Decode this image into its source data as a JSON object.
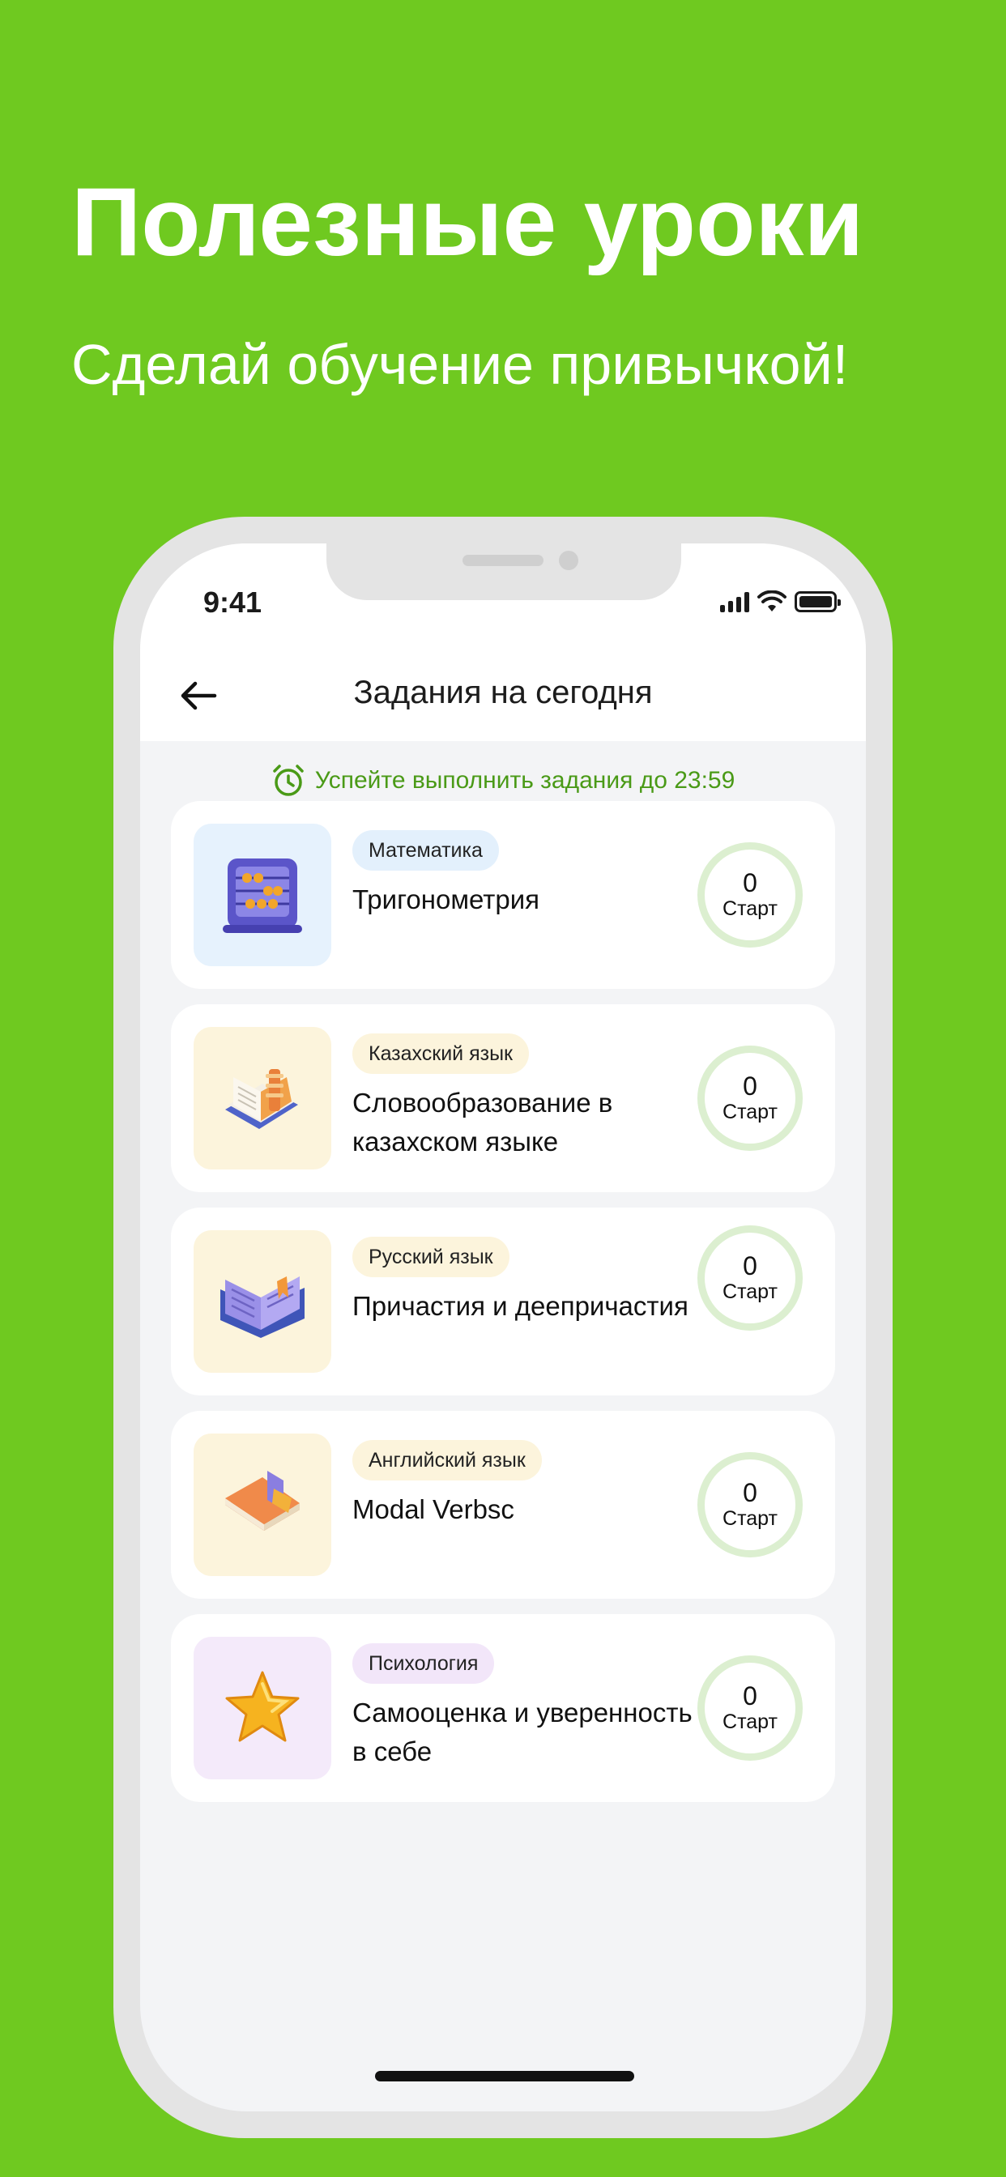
{
  "promo": {
    "title": "Полезные уроки",
    "subtitle": "Сделай обучение привычкой!"
  },
  "status_bar": {
    "time": "9:41",
    "icons": [
      "signal-icon",
      "wifi-icon",
      "battery-icon"
    ]
  },
  "header": {
    "back_icon": "arrow-left-icon",
    "title": "Задания на сегодня"
  },
  "deadline": {
    "icon": "alarm-clock-icon",
    "text": "Успейте выполнить задания до 23:59",
    "color": "#4a9a17"
  },
  "lessons": [
    {
      "subject": "Математика",
      "title": "Тригонометрия",
      "count": "0",
      "action": "Старт",
      "icon": "abacus-icon",
      "thumb_bg": "#e6f2fd",
      "tag_bg": "#e3f0fc"
    },
    {
      "subject": "Казахский язык",
      "title": "Словообразование в казахском языке",
      "count": "0",
      "action": "Старт",
      "icon": "notebook-icon",
      "thumb_bg": "#fcf4dc",
      "tag_bg": "#fcf4dc"
    },
    {
      "subject": "Русский язык",
      "title": "Причастия и деепричастия",
      "count": "0",
      "action": "Старт",
      "icon": "open-book-icon",
      "thumb_bg": "#fcf4dc",
      "tag_bg": "#fcf4dc"
    },
    {
      "subject": "Английский язык",
      "title": "Modal Verbsc",
      "count": "0",
      "action": "Старт",
      "icon": "closed-book-icon",
      "thumb_bg": "#fcf4dc",
      "tag_bg": "#fcf4dc"
    },
    {
      "subject": "Психология",
      "title": "Самооценка и уверенность в себе",
      "count": "0",
      "action": "Старт",
      "icon": "star-icon",
      "thumb_bg": "#f4eafa",
      "tag_bg": "#f2e6f9"
    }
  ]
}
